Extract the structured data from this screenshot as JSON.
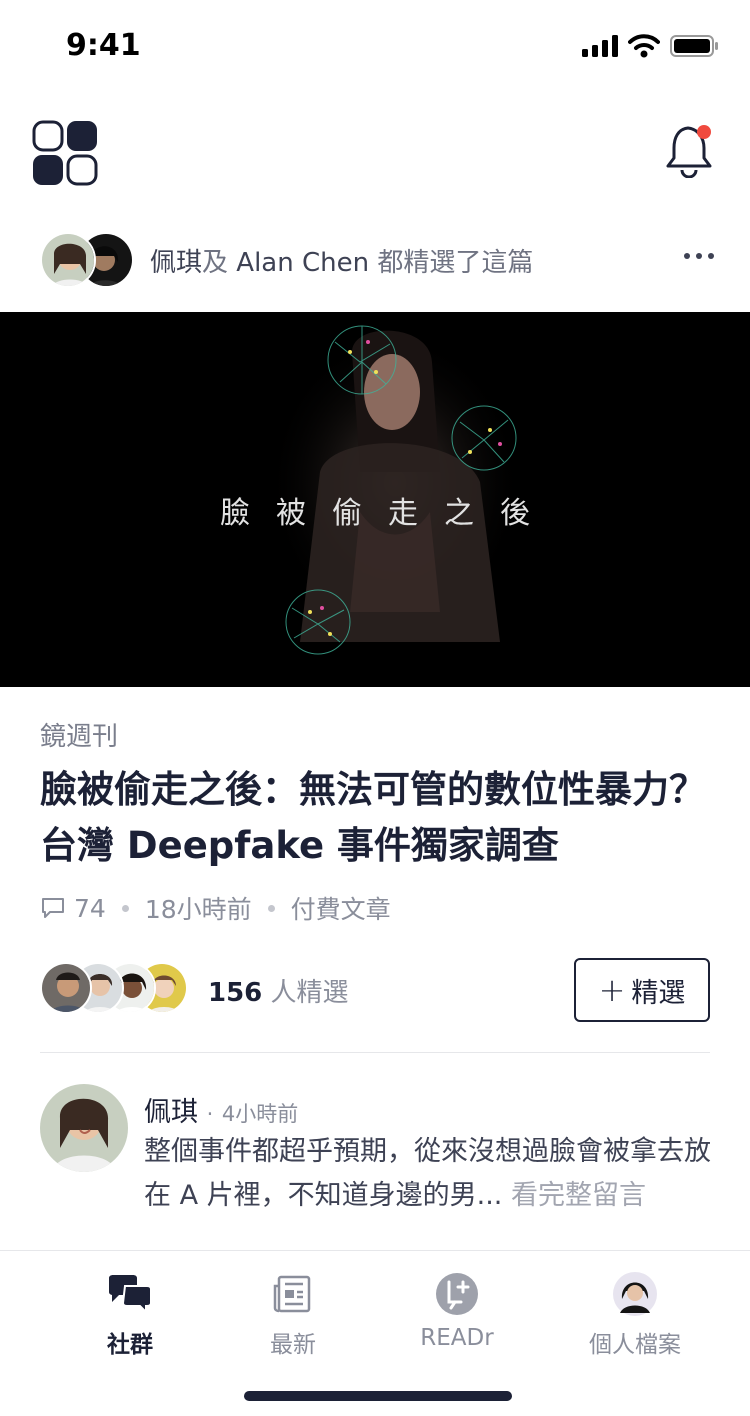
{
  "status_bar": {
    "time": "9:41"
  },
  "colors": {
    "primary": "#1c2136",
    "notification": "#f04a3e",
    "muted": "#8a8e9b"
  },
  "curation": {
    "user1": "佩琪",
    "connector": "及",
    "user2": "Alan Chen",
    "suffix": "都精選了這篇"
  },
  "hero": {
    "image_title": "臉被偷走之後"
  },
  "article": {
    "publisher": "鏡週刊",
    "title": "臉被偷走之後：無法可管的數位性暴力？台灣 Deepfake 事件獨家調查",
    "comment_count": "74",
    "time_ago": "18小時前",
    "tag": "付費文章",
    "picks_count": "156",
    "picks_suffix": "人精選",
    "pick_button_label": "精選",
    "pick_button_plus": "+"
  },
  "comment": {
    "author": "佩琪",
    "separator": "·",
    "time": "4小時前",
    "body": "整個事件都超乎預期，從來沒想過臉會被拿去放在 A 片裡，不知道身邊的男...",
    "read_more": "看完整留言"
  },
  "tabbar": {
    "tabs": [
      {
        "label": "社群",
        "icon": "community-chat-icon",
        "active": true
      },
      {
        "label": "最新",
        "icon": "newspaper-icon",
        "active": false
      },
      {
        "label": "READr",
        "icon": "readr-icon",
        "active": false
      },
      {
        "label": "個人檔案",
        "icon": "profile-avatar-icon",
        "active": false
      }
    ]
  }
}
